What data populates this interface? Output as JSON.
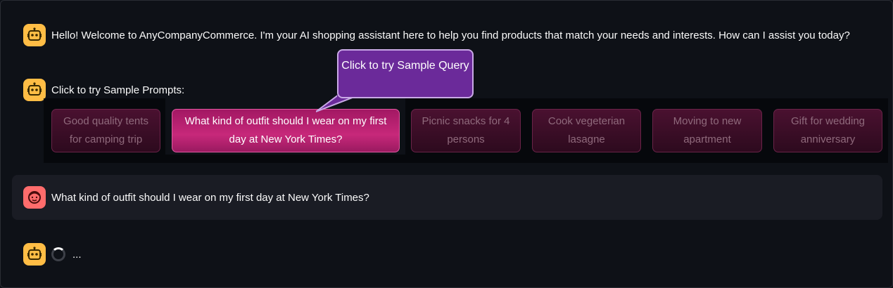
{
  "messages": {
    "welcome": "Hello! Welcome to AnyCompanyCommerce. I'm your AI shopping assistant here to help you find products that match your needs and interests. How can I assist you today?",
    "sample_intro": "Click to try Sample Prompts:",
    "user_query": "What kind of outfit should I wear on my first day at New York Times?",
    "loading": "..."
  },
  "sample_prompts": [
    "Good quality tents for camping trip",
    "What kind of outfit should I wear on my first day at New York Times?",
    "Picnic snacks for 4 persons",
    "Cook vegeterian lasagne",
    "Moving to new apartment",
    "Gift for wedding anniversary"
  ],
  "tooltip": "Click to try Sample Query",
  "icons": {
    "assistant": "robot-icon",
    "user": "smiley-face-icon",
    "loading": "spinner-icon"
  },
  "colors": {
    "background": "#0e1117",
    "bot_avatar": "#ffbd45",
    "user_avatar": "#ff6c6c",
    "active_prompt": "#c7287a",
    "tooltip": "#6b2a9a"
  }
}
